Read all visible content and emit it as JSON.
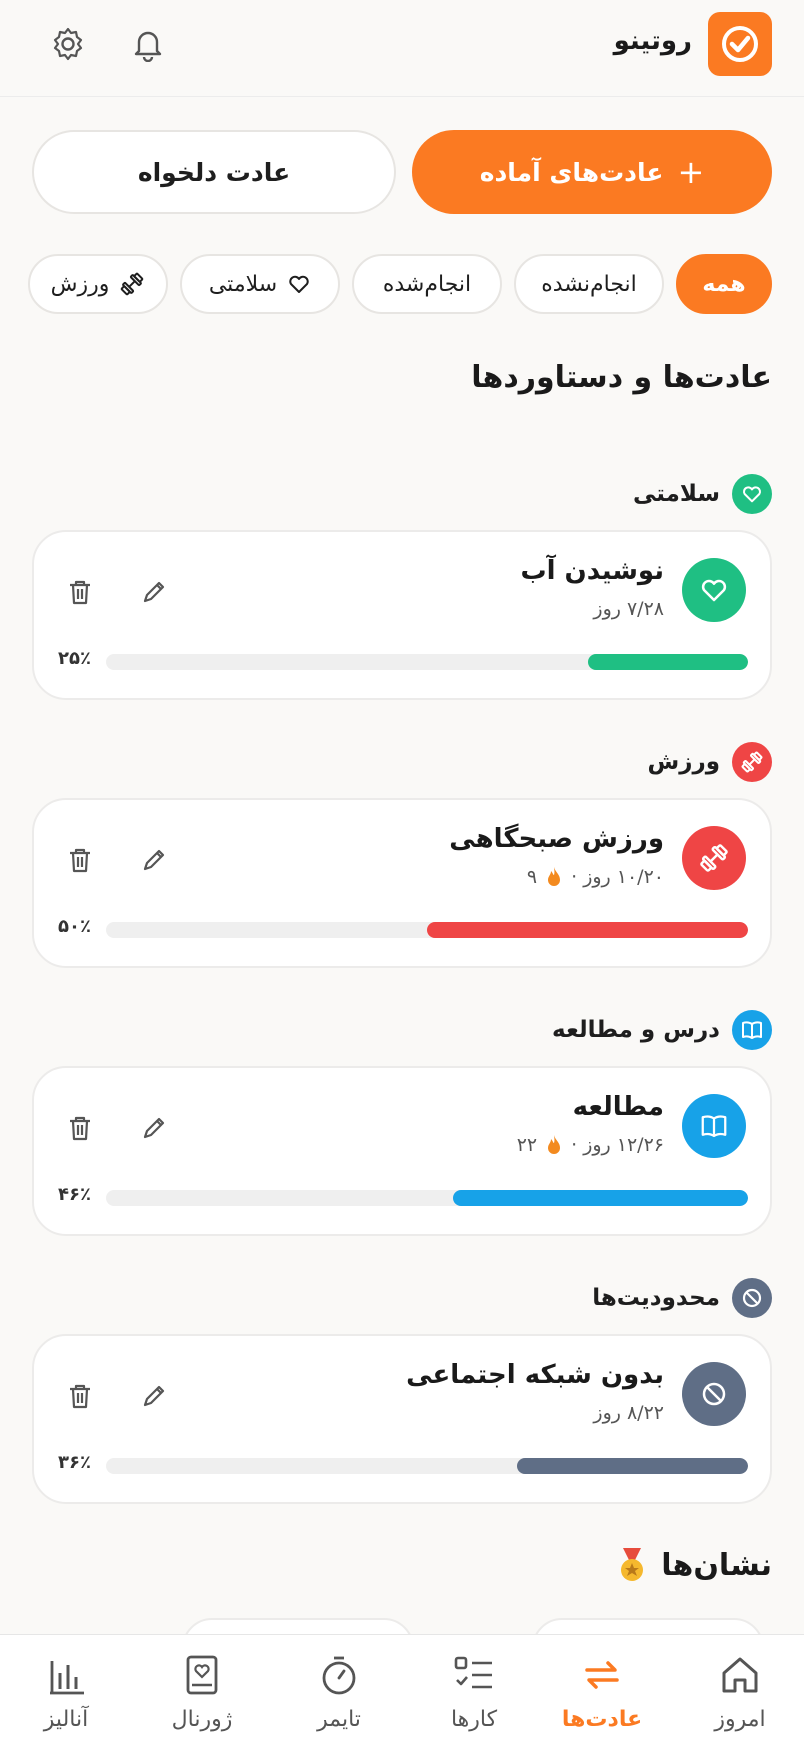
{
  "header": {
    "app_title": "روتینو",
    "logo_icon": "check-circle-icon",
    "notifications_icon": "bell-icon",
    "settings_icon": "gear-icon"
  },
  "actions": {
    "ready_habits": "عادت‌های آماده",
    "ready_plus": "+",
    "custom_habit": "عادت دلخواه"
  },
  "filters": [
    {
      "label": "همه",
      "active": true
    },
    {
      "label": "انجام‌نشده",
      "active": false
    },
    {
      "label": "انجام‌شده",
      "active": false
    },
    {
      "label": "سلامتی",
      "icon": "heart-icon",
      "active": false
    },
    {
      "label": "ورزش",
      "icon": "dumbbell-icon",
      "active": false
    }
  ],
  "section_title": "عادت‌ها و دستاوردها",
  "categories": [
    {
      "name": "سلامتی",
      "color": "#1fbf83",
      "icon": "heart-icon",
      "habit": {
        "name": "نوشیدن آب",
        "meta": "۷/۲۸ روز",
        "streak": "",
        "progress": 25,
        "progress_label": "۲۵٪"
      }
    },
    {
      "name": "ورزش",
      "color": "#ef4545",
      "icon": "dumbbell-icon",
      "habit": {
        "name": "ورزش صبحگاهی",
        "meta": "۱۰/۲۰ روز ·",
        "streak": "۹",
        "progress": 50,
        "progress_label": "۵۰٪"
      }
    },
    {
      "name": "درس و مطالعه",
      "color": "#17a2e8",
      "icon": "book-icon",
      "habit": {
        "name": "مطالعه",
        "meta": "۱۲/۲۶ روز ·",
        "streak": "۲۲",
        "progress": 46,
        "progress_label": "۴۶٪"
      }
    },
    {
      "name": "محدودیت‌ها",
      "color": "#5f6e86",
      "icon": "ban-icon",
      "habit": {
        "name": "بدون شبکه اجتماعی",
        "meta": "۸/۲۲ روز",
        "streak": "",
        "progress": 36,
        "progress_label": "۳۶٪"
      }
    }
  ],
  "badges_title": "نشان‌ها",
  "nav": [
    {
      "label": "امروز",
      "icon": "home-icon",
      "active": false
    },
    {
      "label": "عادت‌ها",
      "icon": "repeat-icon",
      "active": true
    },
    {
      "label": "کارها",
      "icon": "checklist-icon",
      "active": false
    },
    {
      "label": "تایمر",
      "icon": "stopwatch-icon",
      "active": false
    },
    {
      "label": "ژورنال",
      "icon": "journal-icon",
      "active": false
    },
    {
      "label": "آنالیز",
      "icon": "chart-icon",
      "active": false
    }
  ],
  "colors": {
    "accent": "#fb7a22"
  }
}
